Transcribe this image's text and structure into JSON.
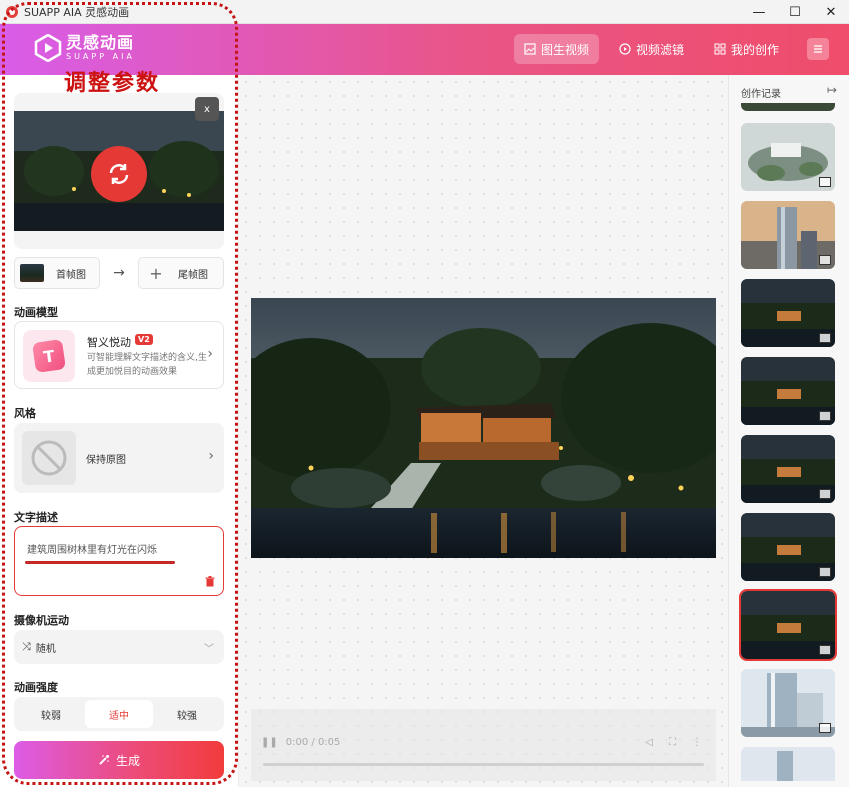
{
  "window": {
    "title": "SUAPP AIA 灵感动画",
    "controls": [
      "—",
      "☐",
      "✕"
    ]
  },
  "header": {
    "logo_cn": "灵感动画",
    "logo_en": "SUAPP AIA",
    "nav": [
      {
        "label": "图生视频",
        "icon": "image-icon",
        "active": true
      },
      {
        "label": "视频滤镜",
        "icon": "play-circle-icon",
        "active": false
      },
      {
        "label": "我的创作",
        "icon": "grid-icon",
        "active": false
      }
    ]
  },
  "annotation": {
    "title": "调整参数",
    "color": "#cc1111"
  },
  "left": {
    "close_label": "x",
    "first_frame_label": "首帧图",
    "last_frame_label": "尾帧图",
    "model_section": "动画模型",
    "model_name": "智义悦动",
    "model_badge": "V2",
    "model_desc": "可智能理解文字描述的含义,生成更加悦目的动画效果",
    "style_section": "风格",
    "style_value": "保持原图",
    "text_section": "文字描述",
    "text_value": "建筑周围树林里有灯光在闪烁",
    "camera_section": "摄像机运动",
    "camera_value": "随机",
    "strength_section": "动画强度",
    "strength_options": [
      {
        "label": "较弱",
        "active": false
      },
      {
        "label": "适中",
        "active": true
      },
      {
        "label": "较强",
        "active": false
      }
    ],
    "generate_label": "生成"
  },
  "player": {
    "time": "0:00 / 0:05"
  },
  "right": {
    "title": "创作记录",
    "thumbs": [
      {
        "kind": "aerial"
      },
      {
        "kind": "tower"
      },
      {
        "kind": "night"
      },
      {
        "kind": "night"
      },
      {
        "kind": "night"
      },
      {
        "kind": "night"
      },
      {
        "kind": "night",
        "selected": true
      },
      {
        "kind": "office"
      },
      {
        "kind": "office2"
      }
    ]
  },
  "colors": {
    "accent": "#e53935",
    "header_start": "#d85de9",
    "header_end": "#ef4d6a"
  }
}
